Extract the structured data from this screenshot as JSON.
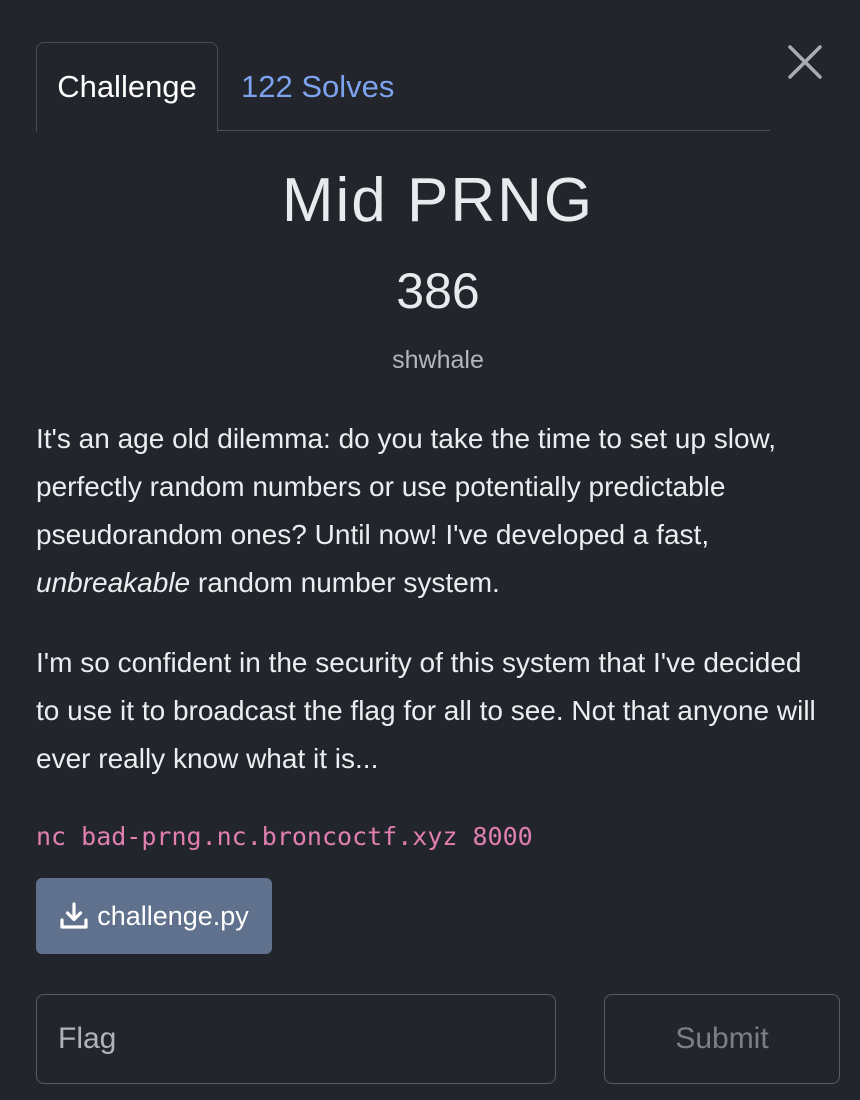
{
  "tabs": {
    "challenge_label": "Challenge",
    "solves_label": "122 Solves"
  },
  "challenge": {
    "title": "Mid PRNG",
    "points": "386",
    "author": "shwhale"
  },
  "description": {
    "p1_before": "It's an age old dilemma: do you take the time to set up slow, perfectly random numbers or use potentially predictable pseudorandom ones? Until now! I've developed a fast, ",
    "p1_emphasis": "unbreakable",
    "p1_after": " random number system.",
    "p2": "I'm so confident in the security of this system that I've decided to use it to broadcast the flag for all to see. Not that anyone will ever really know what it is..."
  },
  "command": "nc bad-prng.nc.broncoctf.xyz 8000",
  "file": {
    "name": "challenge.py",
    "icon": "download-icon"
  },
  "form": {
    "flag_placeholder": "Flag",
    "flag_value": "",
    "submit_label": "Submit"
  },
  "colors": {
    "background": "#22252b",
    "tab_link": "#7ea3ee",
    "command_text": "#e07fb0",
    "download_button": "#5f718c"
  }
}
